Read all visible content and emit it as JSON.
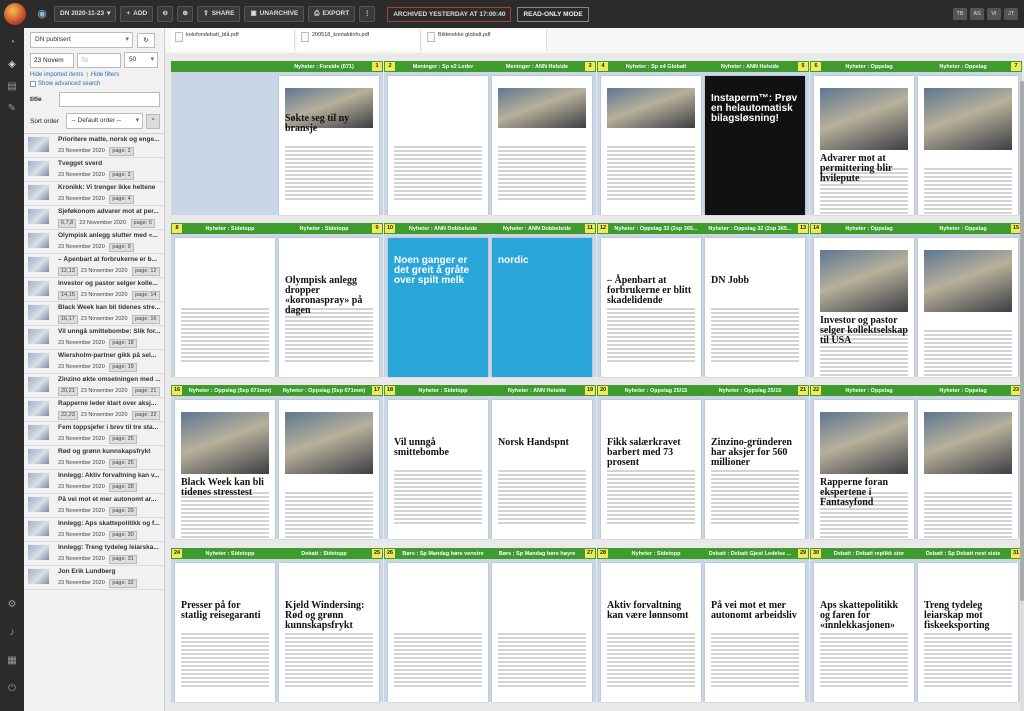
{
  "topbar": {
    "edition": "DN 2020-11-23",
    "add_label": "ADD",
    "share_label": "SHARE",
    "unarchive_label": "UNARCHIVE",
    "export_label": "EXPORT",
    "status": "ARCHIVED YESTERDAY AT 17:00:40",
    "mode": "READ-ONLY MODE",
    "users": [
      "TB",
      "AS",
      "VI",
      "JT"
    ]
  },
  "sidebar": {
    "publication": "DN publisert",
    "date_from": "23 Novem",
    "date_to_placeholder": "To",
    "page_size": "50",
    "hide_imported": "Hide imported items",
    "separator": "|",
    "hide_filters": "Hide filters",
    "advanced": "Show advanced search",
    "title_label": "title",
    "sort_label": "Sort order",
    "sort_value": "-- Default order --",
    "items": [
      {
        "title": "Prioritere matte, norsk og enge...",
        "date": "23 November 2020",
        "page": "page: 2",
        "badge": ""
      },
      {
        "title": "Tvegget sverd",
        "date": "23 November 2020",
        "page": "page: 2",
        "badge": ""
      },
      {
        "title": "Kronikk: Vi trenger ikke heltene",
        "date": "23 November 2020",
        "page": "page: 4",
        "badge": ""
      },
      {
        "title": "Sjeføkonom advarer mot at per...",
        "date": "23 November 2020",
        "page": "page: 6",
        "badge": "6,7,8"
      },
      {
        "title": "Olympisk anlegg slutter med «...",
        "date": "23 November 2020",
        "page": "page: 9",
        "badge": ""
      },
      {
        "title": "– Åpenbart at  forbrukerne er b...",
        "date": "23 November 2020",
        "page": "page: 12",
        "badge": "12,13"
      },
      {
        "title": "Investor og pastor selger kolle...",
        "date": "23 November 2020",
        "page": "page: 14",
        "badge": "14,15"
      },
      {
        "title": "Black Week kan bli tidenes stre...",
        "date": "23 November 2020",
        "page": "page: 16",
        "badge": "16,17"
      },
      {
        "title": "Vil unngå smittebombe: Slik for...",
        "date": "23 November 2020",
        "page": "page: 18",
        "badge": ""
      },
      {
        "title": "Wiersholm-partner gikk på sel...",
        "date": "23 November 2020",
        "page": "page: 19",
        "badge": ""
      },
      {
        "title": "Zinzino økte omsetningen med ...",
        "date": "23 November 2020",
        "page": "page: 21",
        "badge": "20,21"
      },
      {
        "title": "Rapperne leder klart over aksj...",
        "date": "23 November 2020",
        "page": "page: 22",
        "badge": "22,23"
      },
      {
        "title": "Fem toppsjefer i brev til tre sta...",
        "date": "23 November 2020",
        "page": "page: 25",
        "badge": ""
      },
      {
        "title": "Rød og grønn kunnskapsfrykt",
        "date": "23 November 2020",
        "page": "page: 25",
        "badge": ""
      },
      {
        "title": "Innlegg: Aktiv forvaltning kan v...",
        "date": "23 November 2020",
        "page": "page: 28",
        "badge": ""
      },
      {
        "title": "På vei mot et mer autonomt ar...",
        "date": "23 November 2020",
        "page": "page: 29",
        "badge": ""
      },
      {
        "title": "Innlegg: Aps skattepolitikk og f...",
        "date": "23 November 2020",
        "page": "page: 30",
        "badge": ""
      },
      {
        "title": "Innlegg: Treng tydeleg leiarska...",
        "date": "23 November 2020",
        "page": "page: 31",
        "badge": ""
      },
      {
        "title": "Jon Erik Lundberg",
        "date": "23 November 2020",
        "page": "page: 32",
        "badge": ""
      }
    ]
  },
  "files": [
    "kolofondebatt_blå.pdf",
    "200518_kontaktinfo.pdf",
    "Bilderekke globalt.pdf"
  ],
  "spreads": [
    {
      "l_num": "",
      "l_sec": "",
      "r_num": "1",
      "r_sec": "Nyheter : Forside (071)",
      "r_head": "Søkte seg til ny bransje",
      "style": "cover"
    },
    {
      "l_num": "2",
      "l_sec": "Meninger : Sp s2 Leder",
      "r_num": "3",
      "r_sec": "Meninger : ANN Helside",
      "l_head": "",
      "r_head": "",
      "style": "watch"
    },
    {
      "l_num": "4",
      "l_sec": "Nyheter : Sp s4 Globalt",
      "r_num": "5",
      "r_sec": "Nyheter : ANN Helside",
      "l_head": "",
      "r_head": "Instaperm™: Prøv en helautomatisk bilagsløsning!",
      "style": "instaperm"
    },
    {
      "l_num": "6",
      "l_sec": "Nyheter : Oppslag",
      "r_num": "7",
      "r_sec": "Nyheter : Oppslag",
      "l_head": "Advarer mot at permittering blir hvilepute",
      "style": "photo"
    },
    {
      "l_num": "8",
      "l_sec": "Nyheter : Sidetopp",
      "r_num": "9",
      "r_sec": "Nyheter : Sidetopp",
      "r_head": "Olympisk anlegg dropper «koronaspray» på dagen",
      "style": "text"
    },
    {
      "l_num": "10",
      "l_sec": "Nyheter : ANN Dobbelside",
      "r_num": "11",
      "r_sec": "Nyheter : ANN Dobbelside",
      "l_head": "Noen ganger er det greit å gråte over spilt melk",
      "r_head": "nordic",
      "style": "milk"
    },
    {
      "l_num": "12",
      "l_sec": "Nyheter : Oppslag 32 (2sp 365...",
      "r_num": "13",
      "r_sec": "Nyheter : Oppslag 32 (2sp 365...",
      "l_head": "– Åpenbart at forbrukerne er blitt skadelidende",
      "r_head": "DN Jobb",
      "style": "text"
    },
    {
      "l_num": "14",
      "l_sec": "Nyheter : Oppslag",
      "r_num": "15",
      "r_sec": "Nyheter : Oppslag",
      "l_head": "Investor og pastor selger kollektselskap til USA",
      "style": "photo"
    },
    {
      "l_num": "16",
      "l_sec": "Nyheter : Oppslag (5sp 071mm)",
      "r_num": "17",
      "r_sec": "Nyheter : Oppslag (5sp 071mm)",
      "l_head": "Black Week kan bli tidenes stresstest",
      "style": "photo"
    },
    {
      "l_num": "18",
      "l_sec": "Nyheter : Sidetopp",
      "r_num": "19",
      "r_sec": "Nyheter : ANN Helside",
      "l_head": "Vil unngå smittebombe",
      "r_head": "Norsk Handspnt",
      "style": "text"
    },
    {
      "l_num": "20",
      "l_sec": "Nyheter : Oppslag 25/15",
      "r_num": "21",
      "r_sec": "Nyheter : Oppslag 25/15",
      "l_head": "Fikk salærkravet barbert med 73 prosent",
      "r_head": "Zinzino-gründeren har aksjer for 560 millioner",
      "style": "text"
    },
    {
      "l_num": "22",
      "l_sec": "Nyheter : Oppslag",
      "r_num": "23",
      "r_sec": "Nyheter : Oppslag",
      "l_head": "Rapperne foran ekspertene i Fantasyfond",
      "style": "photo"
    },
    {
      "l_num": "24",
      "l_sec": "Nyheter : Sidetopp",
      "r_num": "25",
      "r_sec": "Debatt : Sidetopp",
      "l_head": "Presser på for statlig reisegaranti",
      "r_head": "Kjeld Windersing: Rød og grønn kunnskapsfrykt",
      "style": "text"
    },
    {
      "l_num": "26",
      "l_sec": "Børs : Sp Mandag børs venstre",
      "r_num": "27",
      "r_sec": "Børs : Sp Mandag børs høyre",
      "style": "tables"
    },
    {
      "l_num": "28",
      "l_sec": "Nyheter : Sidetopp",
      "r_num": "29",
      "r_sec": "Debatt : Debatt Gjest Ledelse ...",
      "l_head": "Aktiv forvaltning kan være lønnsomt",
      "r_head": "På vei mot et mer autonomt arbeidsliv",
      "style": "text"
    },
    {
      "l_num": "30",
      "l_sec": "Debatt : Debatt replikk stor",
      "r_num": "31",
      "r_sec": "Debatt : Sp Debatt nest siste",
      "l_head": "Aps skattepolitikk og faren for «innlekkasjonen»",
      "r_head": "Treng tydeleg leiarskap mot fiskeeksporting",
      "style": "text"
    }
  ]
}
